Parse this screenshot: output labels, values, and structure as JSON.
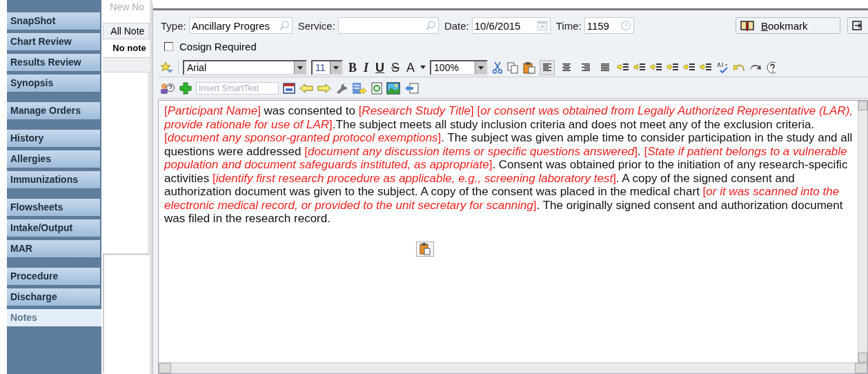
{
  "sidebar": {
    "groups": [
      [
        {
          "label": "SnapShot",
          "selected": false
        },
        {
          "label": "Chart Review",
          "selected": false
        },
        {
          "label": "Results Review",
          "selected": false
        },
        {
          "label": "Synopsis",
          "selected": false
        }
      ],
      [
        {
          "label": "Manage Orders",
          "selected": false
        }
      ],
      [
        {
          "label": "History",
          "selected": false
        },
        {
          "label": "Allergies",
          "selected": false
        },
        {
          "label": "Immunizations",
          "selected": false
        }
      ],
      [
        {
          "label": "Flowsheets",
          "selected": false
        },
        {
          "label": "Intake/Output",
          "selected": false
        },
        {
          "label": "MAR",
          "selected": false
        }
      ],
      [
        {
          "label": "Procedure",
          "selected": false
        },
        {
          "label": "Discharge",
          "selected": false
        },
        {
          "label": "Notes",
          "selected": true
        }
      ]
    ]
  },
  "notes_list": {
    "new_button": "New No",
    "tab": "All Note",
    "empty_text": "No note"
  },
  "editor": {
    "type": {
      "label": "Type:",
      "value": "Ancillary Progres"
    },
    "service": {
      "label": "Service:"
    },
    "date": {
      "label": "Date:",
      "value": "10/6/2015"
    },
    "time": {
      "label": "Time:",
      "value": "1159"
    },
    "bookmark_button": "Bookmark",
    "cosign": {
      "label": "Cosign Required",
      "checked": false
    },
    "font": "Arial",
    "size": "11",
    "zoom": "100%",
    "format_buttons": [
      {
        "kind": "bold",
        "label": "B"
      },
      {
        "kind": "italic",
        "label": "I"
      },
      {
        "kind": "underline",
        "label": "U"
      },
      {
        "kind": "strike",
        "label": "S"
      },
      {
        "kind": "color",
        "label": "A"
      }
    ],
    "align_buttons": [
      {
        "kind": "left",
        "selected": true
      },
      {
        "kind": "center",
        "selected": false
      },
      {
        "kind": "right",
        "selected": false
      },
      {
        "kind": "justify",
        "selected": false
      }
    ],
    "smarttext": {
      "placeholder": "Insert SmartText"
    },
    "note": [
      {
        "kind": "field",
        "text": "[*Participant Name*]"
      },
      {
        "kind": "plain",
        "text": " was consented to "
      },
      {
        "kind": "field",
        "text": "[*Research Study Title*]"
      },
      {
        "kind": "field",
        "text": " [*or consent was obtained from Legally Authorized Representative (LAR), provide rationale for use of LAR*]"
      },
      {
        "kind": "plain",
        "text": ".The subject meets all study inclusion criteria and does not meet any of the exclusion criteria. "
      },
      {
        "kind": "field",
        "text": "[*document any sponsor-granted protocol exemptions*]"
      },
      {
        "kind": "plain",
        "text": ". The subject was given ample time to consider participation in the study and all questions were addressed "
      },
      {
        "kind": "field",
        "text": "[*document any discussion items or specific questions answered*]"
      },
      {
        "kind": "plain",
        "text": ". "
      },
      {
        "kind": "field",
        "text": "[*State if  patient belongs to a vulnerable population and document safeguards instituted, as appropriate*]"
      },
      {
        "kind": "plain",
        "text": ". Consent was obtained prior to the initiation of any research-specific activities "
      },
      {
        "kind": "field",
        "text": "[*identify first research procedure as applicable, e.g., screening laboratory test*]"
      },
      {
        "kind": "plain",
        "text": ". A copy of the signed consent and authorization document was given to the subject. A copy of the consent was placed in the medical chart "
      },
      {
        "kind": "field",
        "text": "[*or it was scanned into the electronic medical record, or provided to the unit secretary for scanning*]"
      },
      {
        "kind": "plain",
        "text": ". The originally signed consent and authorization document was filed in the research record."
      }
    ]
  }
}
